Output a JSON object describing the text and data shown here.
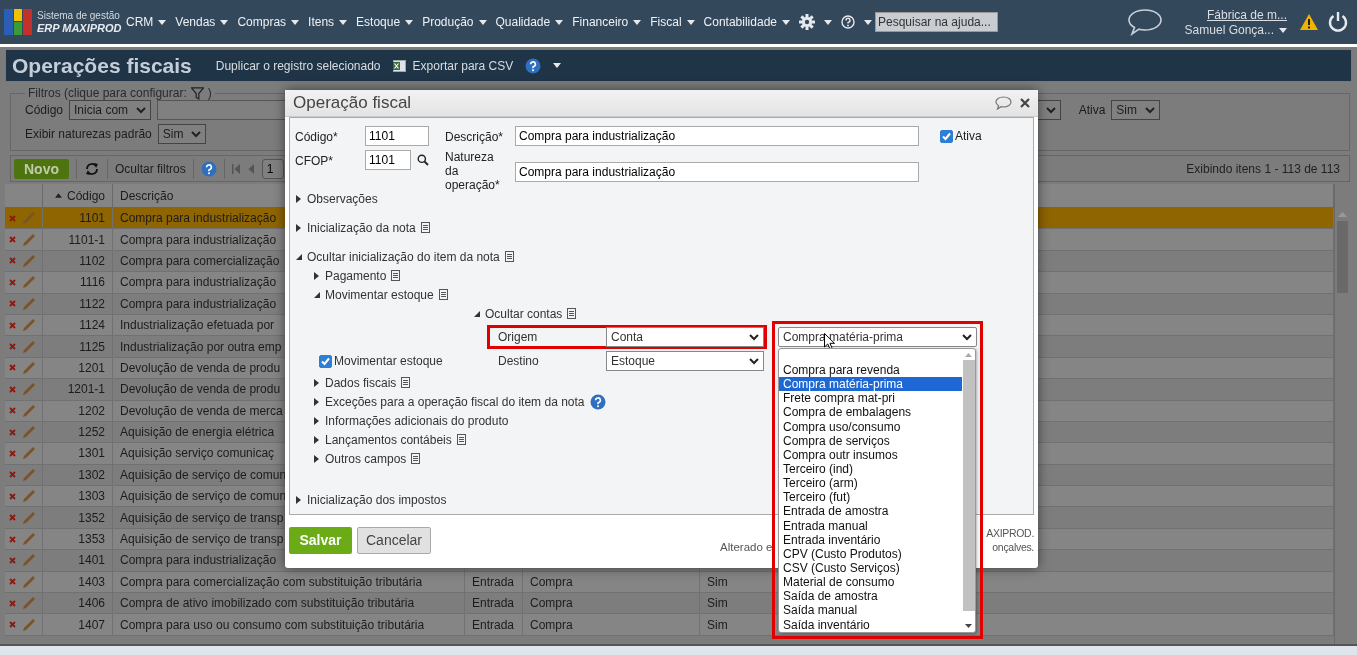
{
  "app": {
    "system_label": "Sistema de gestão",
    "product": "ERP MAXIPROD"
  },
  "menu": [
    {
      "label": "CRM"
    },
    {
      "label": "Vendas"
    },
    {
      "label": "Compras"
    },
    {
      "label": "Itens"
    },
    {
      "label": "Estoque"
    },
    {
      "label": "Produção"
    },
    {
      "label": "Qualidade"
    },
    {
      "label": "Financeiro"
    },
    {
      "label": "Fiscal"
    },
    {
      "label": "Contabilidade"
    }
  ],
  "help_search": {
    "placeholder": "Pesquisar na ajuda..."
  },
  "account": {
    "company": "Fábrica de m...",
    "user": "Samuel Gonça..."
  },
  "page": {
    "title": "Operações fiscais",
    "duplicate": "Duplicar o registro selecionado",
    "export": "Exportar para CSV"
  },
  "filters": {
    "legend": "Filtros (clique para configurar:",
    "legend_end": ")",
    "code_label": "Código",
    "code_mode": "Inicia com",
    "active_label": "Ativa",
    "active_value": "Sim",
    "default_label": "Exibir naturezas padrão",
    "default_value": "Sim"
  },
  "toolbar": {
    "new": "Novo",
    "hide_filters": "Ocultar filtros",
    "page": "1",
    "summary": "Exibindo itens 1 - 113 de 113"
  },
  "table": {
    "columns": [
      "Código",
      "Descrição"
    ],
    "rows": [
      {
        "code": "1101",
        "description": "Compra para industrialização",
        "selected": true
      },
      {
        "code": "1101-1",
        "description": "Compra para industrialização",
        "selected": false
      },
      {
        "code": "1102",
        "description": "Compra para comercialização",
        "selected": false
      },
      {
        "code": "1116",
        "description": "Compra para industrialização",
        "selected": false
      },
      {
        "code": "1122",
        "description": "Compra para industrialização",
        "selected": false
      },
      {
        "code": "1124",
        "description": "Industrialização efetuada por",
        "selected": false
      },
      {
        "code": "1125",
        "description": "Industrialização por outra emp",
        "selected": false
      },
      {
        "code": "1201",
        "description": "Devolução de venda de produ",
        "selected": false
      },
      {
        "code": "1201-1",
        "description": "Devolução de venda de produ",
        "selected": false
      },
      {
        "code": "1202",
        "description": "Devolução de venda de merca",
        "selected": false
      },
      {
        "code": "1252",
        "description": "Aquisição de energia elétrica",
        "selected": false
      },
      {
        "code": "1301",
        "description": "Aquisição serviço comunicaç",
        "selected": false
      },
      {
        "code": "1302",
        "description": "Aquisição de serviço de comun",
        "selected": false
      },
      {
        "code": "1303",
        "description": "Aquisição de serviço de comun",
        "selected": false
      },
      {
        "code": "1352",
        "description": "Aquisição de serviço de transp",
        "selected": false
      },
      {
        "code": "1353",
        "description": "Aquisição de serviço de transp",
        "selected": false
      },
      {
        "code": "1401",
        "description": "Compra para industrialização",
        "selected": false
      },
      {
        "code": "1403",
        "description": "Compra para comercialização com substituição tributária",
        "column_3": "Entrada",
        "column_4": "Compra",
        "column_5": "Sim",
        "selected": false
      },
      {
        "code": "1406",
        "description": "Compra de ativo imobilizado com substituição tributária",
        "column_3": "Entrada",
        "column_4": "Compra",
        "column_5": "Sim",
        "selected": false
      },
      {
        "code": "1407",
        "description": "Compra para uso ou consumo com substituição tributária",
        "column_3": "Entrada",
        "column_4": "Compra",
        "column_5": "Sim",
        "selected": false
      }
    ]
  },
  "dialog": {
    "title": "Operação fiscal",
    "code_label": "Código*",
    "code": "1101",
    "description_label": "Descrição*",
    "description": "Compra para industrialização",
    "active_label": "Ativa",
    "active_checked": true,
    "cfop_label": "CFOP*",
    "cfop": "1101",
    "nature_label": "Natureza da operação*",
    "nature": "Compra para industrialização",
    "sections": [
      {
        "kind": "plain",
        "label": "Observações",
        "expanded": false
      },
      {
        "kind": "noted",
        "label": "Inicialização da nota",
        "expanded": false
      },
      {
        "kind": "noted",
        "label": "Ocultar inicialização do item da nota",
        "expanded": true,
        "children": [
          {
            "kind": "noted",
            "label": "Pagamento",
            "expanded": false
          },
          {
            "kind": "stock",
            "label": "Movimentar estoque",
            "expanded": true
          },
          {
            "kind": "noted",
            "label": "Dados fiscais",
            "expanded": false
          },
          {
            "kind": "helped",
            "label": "Exceções para a operação fiscal do item da nota",
            "expanded": false
          },
          {
            "kind": "plain",
            "label": "Informações adicionais do produto",
            "expanded": false
          },
          {
            "kind": "noted",
            "label": "Lançamentos contábeis",
            "expanded": false
          },
          {
            "kind": "noted",
            "label": "Outros campos",
            "expanded": false
          }
        ]
      },
      {
        "kind": "plain",
        "label": "Inicialização dos impostos",
        "expanded": false
      }
    ],
    "stock": {
      "accounts_label": "Ocultar contas",
      "accounts_expanded": true,
      "origin_label": "Origem",
      "origin_value": "Conta",
      "move_label": "Movimentar estoque",
      "move_checked": true,
      "destination_label": "Destino",
      "destination_value": "Estoque",
      "account_value": "Compra matéria-prima",
      "account_options": [
        {
          "label": "Compra para revenda",
          "selected": false
        },
        {
          "label": "Compra matéria-prima",
          "selected": true
        },
        {
          "label": "Frete compra mat-pri",
          "selected": false
        },
        {
          "label": "Compra de embalagens",
          "selected": false
        },
        {
          "label": "Compra uso/consumo",
          "selected": false
        },
        {
          "label": "Compra de serviços",
          "selected": false
        },
        {
          "label": "Compra outr insumos",
          "selected": false
        },
        {
          "label": "Terceiro (ind)",
          "selected": false
        },
        {
          "label": "Terceiro (arm)",
          "selected": false
        },
        {
          "label": "Terceiro (fut)",
          "selected": false
        },
        {
          "label": "Entrada de amostra",
          "selected": false
        },
        {
          "label": "Entrada manual",
          "selected": false
        },
        {
          "label": "Entrada inventário",
          "selected": false
        },
        {
          "label": "CPV (Custo Produtos)",
          "selected": false
        },
        {
          "label": "CSV (Custo Serviços)",
          "selected": false
        },
        {
          "label": "Material de consumo",
          "selected": false
        },
        {
          "label": "Saída de amostra",
          "selected": false
        },
        {
          "label": "Saída manual",
          "selected": false
        },
        {
          "label": "Saída inventário",
          "selected": false
        }
      ]
    },
    "save": "Salvar",
    "cancel": "Cancelar",
    "audit_line_1_end": "AXIPROD.",
    "audit_line_2_start": "Alterado e",
    "audit_line_2_end": "onçalves."
  }
}
